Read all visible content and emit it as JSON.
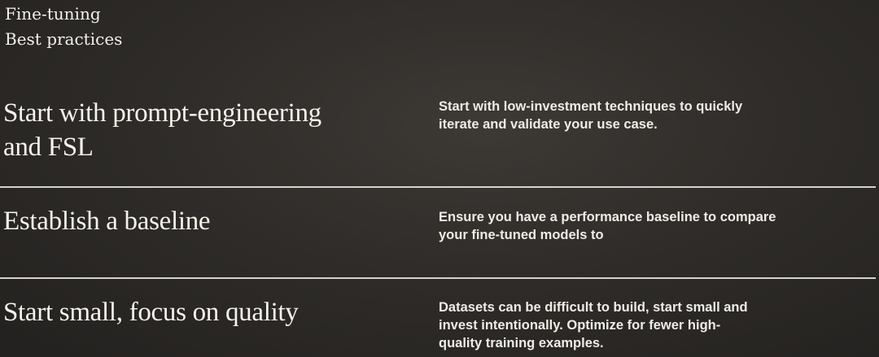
{
  "header": {
    "title": "Fine-tuning",
    "subtitle": "Best practices"
  },
  "rows": [
    {
      "title": "Start with prompt-engineering and FSL",
      "description": "Start with low-investment techniques to quickly iterate and validate your use case."
    },
    {
      "title": "Establish a baseline",
      "description": "Ensure you have a performance baseline to compare your fine-tuned models to"
    },
    {
      "title": "Start small, focus on quality",
      "description": "Datasets can be difficult to build, start small and invest intentionally. Optimize for fewer high-quality training examples."
    }
  ]
}
